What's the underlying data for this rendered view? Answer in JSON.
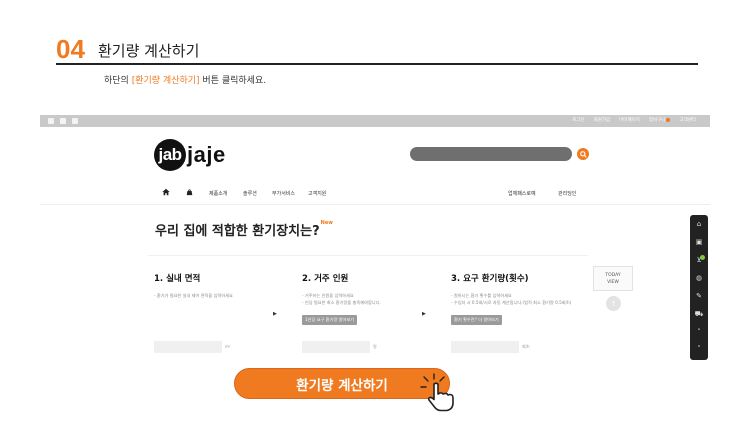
{
  "guide": {
    "step_number": "04",
    "step_title": "환기량 계산하기",
    "desc_prefix": "하단의 ",
    "desc_highlight": "[환기량 계산하기]",
    "desc_suffix": " 버튼 클릭하세요."
  },
  "site": {
    "top_links": [
      "로그인",
      "회원가입",
      "마이페이지",
      "장바구니",
      "고객센터"
    ],
    "logo_badge": "jab",
    "logo_rest": "jaje",
    "search_icon": "search-icon",
    "menu": {
      "left": [
        "제품소개",
        "솔루션",
        "부가서비스",
        "고객지원"
      ],
      "right": [
        "업체패스로예",
        "관리딩인"
      ]
    },
    "headline": "우리 집에 적합한 환기장치는?",
    "headline_badge": "New",
    "calculator": {
      "steps": [
        {
          "title": "1. 실내 면적",
          "desc": [
            "- 환기가 필요한 실내 제어 면적을 입력하세요"
          ],
          "button": "",
          "unit": "m²"
        },
        {
          "title": "2. 거주 인원",
          "desc": [
            "- 거주하는 인원을 입력하세요",
            "- 인당 필요한 최소 환기량을 충족해야합니다."
          ],
          "button": "1인당 요구 환기량 알아보기",
          "unit": "명"
        },
        {
          "title": "3. 요구 환기량(횟수)",
          "desc": [
            "- 원하시는 환기 횟수를 입력하세요",
            "- 수입처 시 0.5회/시로 자동 계산됩니다.(법적 최소 환기량 0.5회/h)"
          ],
          "button": "환기 횟수란? 더 알아보기",
          "unit": "회/h"
        }
      ],
      "today_view": [
        "TODAY",
        "VIEW"
      ]
    },
    "quick_menu_icons": [
      "home-icon",
      "calendar-icon",
      "cart-icon",
      "chat-icon",
      "edit-icon",
      "truck-icon",
      "chevron-up-icon",
      "chevron-down-icon"
    ],
    "cta_label": "환기량 계산하기"
  },
  "colors": {
    "accent": "#f07a20",
    "search_bar": "#6f6f6f",
    "quick_menu": "#222222"
  }
}
